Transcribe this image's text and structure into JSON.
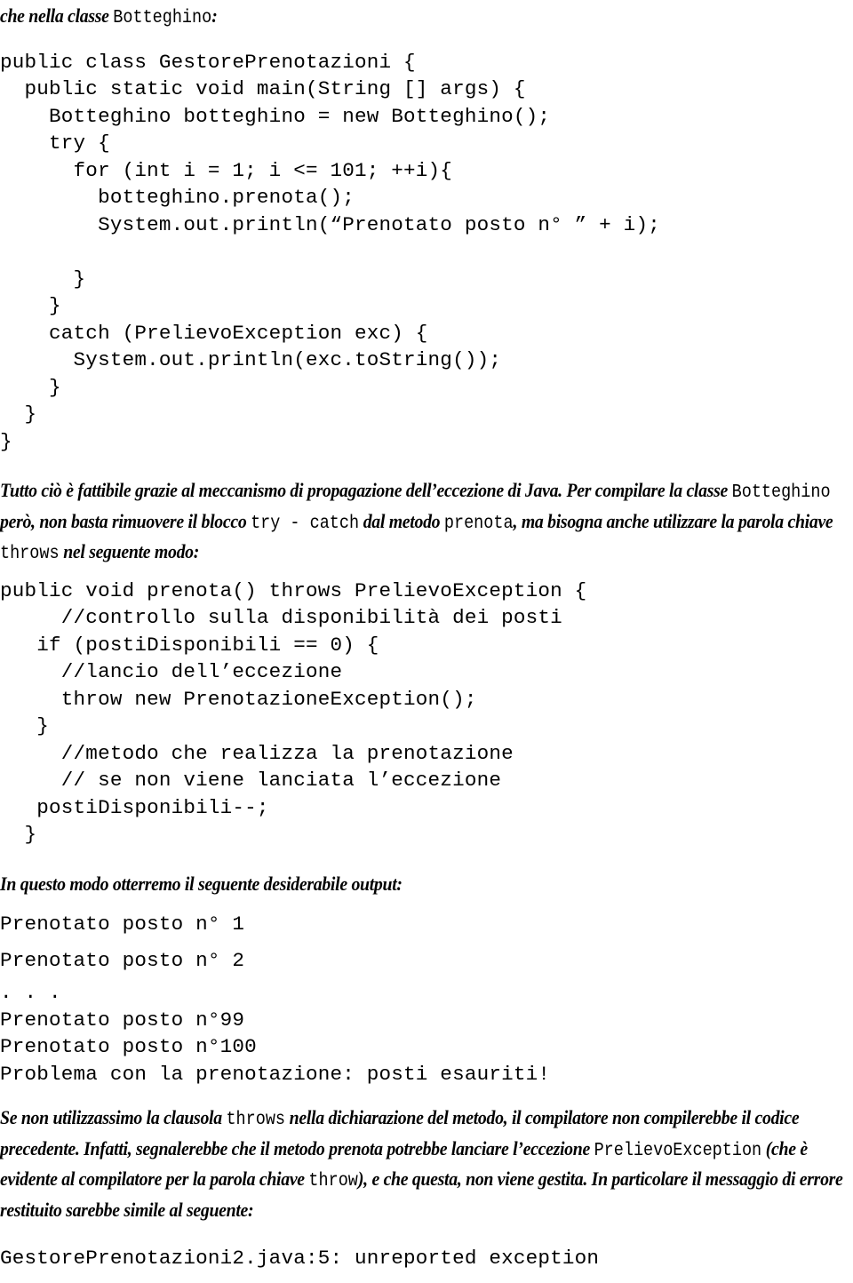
{
  "document": {
    "language": "it",
    "heading": {
      "prose_prefix": "che nella classe ",
      "mono_term": "Botteghino",
      "suffix": ":"
    },
    "code_block_1": {
      "name": "GestorePrenotazioni-main-listing",
      "lines": [
        "public class GestorePrenotazioni {",
        "  public static void main(String [] args) {",
        "    Botteghino botteghino = new Botteghino();",
        "    try {",
        "      for (int i = 1; i <= 101; ++i){",
        "        botteghino.prenota();",
        "        System.out.println(“Prenotato posto n° ” + i);",
        "",
        "      }",
        "    }",
        "    catch (PrelievoException exc) {",
        "      System.out.println(exc.toString());",
        "    }",
        "  }",
        "}"
      ]
    },
    "paragraph_1": {
      "segments": [
        {
          "type": "prose",
          "text": "Tutto ciò è fattibile grazie al meccanismo di  propagazione dell’eccezione di Java. Per compilare la classe "
        },
        {
          "type": "mono",
          "text": "Botteghino"
        },
        {
          "type": "prose",
          "text": " però, non basta rimuovere il blocco "
        },
        {
          "type": "mono",
          "text": "try - catch"
        },
        {
          "type": "prose",
          "text": " dal metodo "
        },
        {
          "type": "mono",
          "text": "prenota"
        },
        {
          "type": "prose",
          "text": ", ma bisogna anche utilizzare la parola chiave "
        },
        {
          "type": "mono",
          "text": "throws"
        },
        {
          "type": "prose",
          "text": " nel seguente modo:"
        }
      ]
    },
    "code_block_2": {
      "name": "prenota-throws-listing",
      "lines": [
        "public void prenota() throws PrelievoException {",
        "     //controllo sulla disponibilità dei posti",
        "   if (postiDisponibili == 0) {",
        "     //lancio dell’eccezione",
        "     throw new PrenotazioneException();",
        "   }",
        "     //metodo che realizza la prenotazione",
        "     // se non viene lanciata l’eccezione",
        "   postiDisponibili--;",
        "  }"
      ]
    },
    "paragraph_2": {
      "segments": [
        {
          "type": "prose",
          "text": "In questo modo otterremo il seguente desiderabile output:"
        }
      ]
    },
    "output_block": {
      "name": "program-output",
      "spaced_lines": [
        "Prenotato posto n° 1",
        "Prenotato posto n° 2"
      ],
      "tight_lines": [
        ". . .",
        "Prenotato posto n°99",
        "Prenotato posto n°100",
        "Problema con la prenotazione: posti esauriti!"
      ]
    },
    "paragraph_3": {
      "segments": [
        {
          "type": "prose",
          "text": "Se non utilizzassimo la clausola "
        },
        {
          "type": "mono",
          "text": "throws"
        },
        {
          "type": "prose",
          "text": " nella dichiarazione del metodo, il compilatore non compilerebbe il codice precedente. Infatti, segnalerebbe che il metodo prenota potrebbe lanciare l’eccezione "
        },
        {
          "type": "mono",
          "text": "PrelievoException"
        },
        {
          "type": "prose",
          "text": " (che è evidente al compilatore per la  parola chiave "
        },
        {
          "type": "mono",
          "text": "throw"
        },
        {
          "type": "prose",
          "text": "), e che questa, non viene gestita. In particolare il messaggio di errore restituito sarebbe simile al seguente:"
        }
      ]
    },
    "error_block": {
      "name": "compiler-error-output",
      "lines": [
        "GestorePrenotazioni2.java:5: unreported exception"
      ]
    }
  }
}
